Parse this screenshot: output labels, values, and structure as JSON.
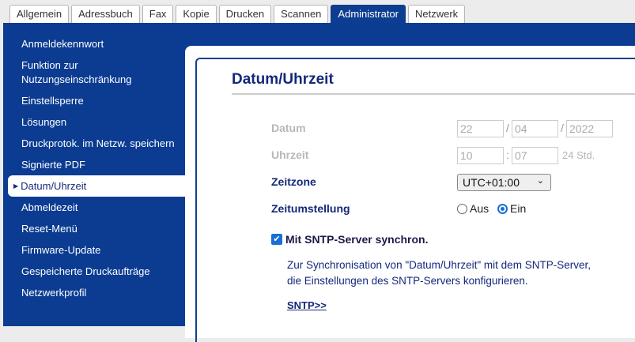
{
  "tabs": [
    "Allgemein",
    "Adressbuch",
    "Fax",
    "Kopie",
    "Drucken",
    "Scannen",
    "Administrator",
    "Netzwerk"
  ],
  "sidebar": {
    "items": [
      "Anmeldekennwort",
      "Funktion zur",
      "Nutzungseinschränkung",
      "Einstellsperre",
      "Lösungen",
      "Druckprotok. im Netzw. speichern",
      "Signierte PDF",
      "Datum/Uhrzeit",
      "Abmeldezeit",
      "Reset-Menü",
      "Firmware-Update",
      "Gespeicherte Druckaufträge",
      "Netzwerkprofil"
    ]
  },
  "main": {
    "title": "Datum/Uhrzeit",
    "date_label": "Datum",
    "day": "22",
    "month": "04",
    "year": "2022",
    "date_sep": "/",
    "time_label": "Uhrzeit",
    "hour": "10",
    "minute": "07",
    "time_sep": ":",
    "time_format": "24 Std.",
    "timezone_label": "Zeitzone",
    "timezone_value": "UTC+01:00",
    "dst_label": "Zeitumstellung",
    "dst_off": "Aus",
    "dst_on": "Ein",
    "dst_selected": "Ein",
    "sntp_checkbox": "Mit SNTP-Server synchron.",
    "sntp_checked": true,
    "desc_line1": "Zur Synchronisation von \"Datum/Uhrzeit\" mit dem SNTP-Server,",
    "desc_line2": "die Einstellungen des SNTP-Servers konfigurieren.",
    "sntp_link": "SNTP>>"
  }
}
